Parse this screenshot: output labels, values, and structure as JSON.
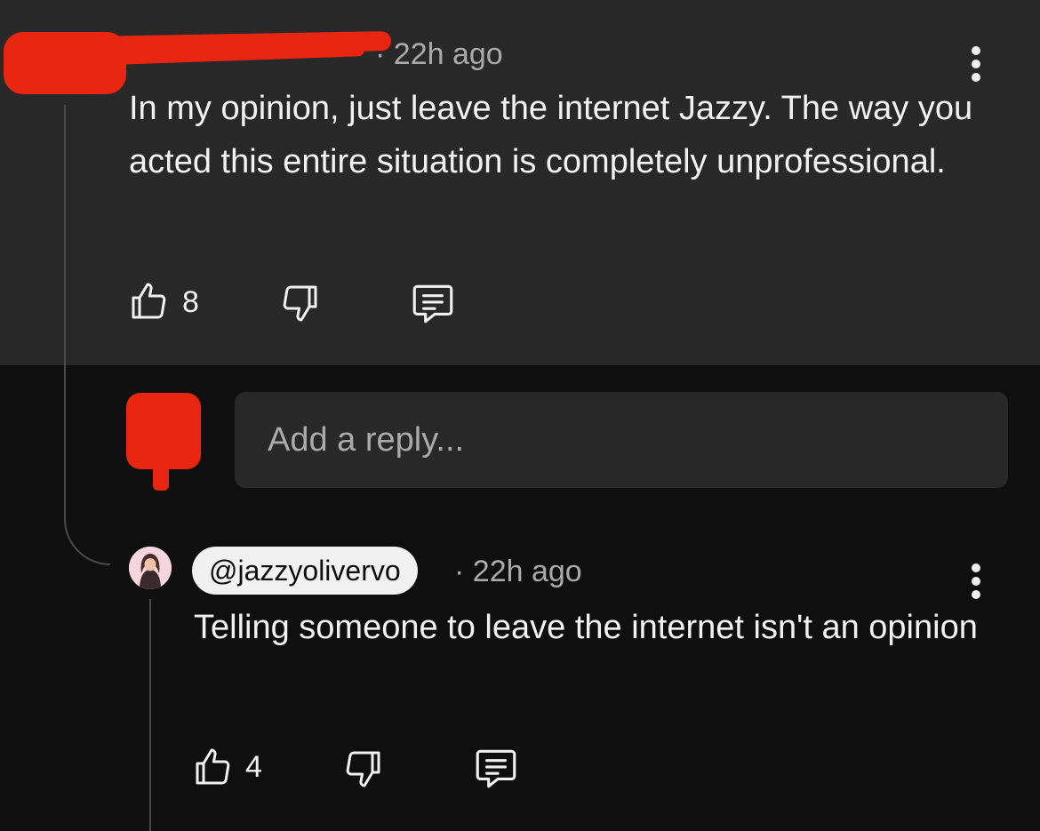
{
  "comment": {
    "time": "22h ago",
    "text": "In my opinion, just leave the internet Jazzy. The way you acted this entire situation is completely unprofessional.",
    "like_count": "8"
  },
  "reply_box": {
    "placeholder": "Add a reply..."
  },
  "reply": {
    "handle": "@jazzyolivervo",
    "time": "22h ago",
    "text": "Telling someone to leave the internet isn't an opinion",
    "like_count": "4"
  },
  "colors": {
    "background": "#0f0f0f",
    "panel": "#282828",
    "redaction": "#e8260f",
    "secondary_text": "#aaaaaa"
  },
  "icons": [
    "thumbs-up-icon",
    "thumbs-down-icon",
    "reply-comment-icon",
    "more-vert-icon"
  ]
}
